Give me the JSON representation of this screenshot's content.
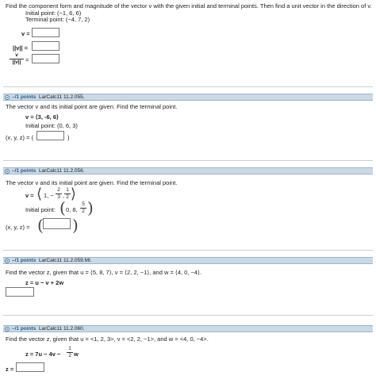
{
  "q1": {
    "instructions": "Find the component form and magnitude of the vector v with the given initial and terminal points. Then find a unit vector in the direction of v.",
    "initial_point": "Initial point: (−1, 6, 6)",
    "terminal_point": "Terminal point: (−4, 7, 2)",
    "v_label": "v =",
    "mag_label": "||v|| =",
    "unit_num": "v",
    "unit_den": "||v||",
    "equals": "="
  },
  "q2": {
    "points": "–/1 points",
    "source": "LarCalc11 11.2.055.",
    "instructions": "The vector v and its initial point are given. Find the terminal point.",
    "vector": "v = ⟨3, -6, 6⟩",
    "initial_point": "Initial point: (0, 6, 3)",
    "answer_label": "(x, y, z) = (",
    "close_paren": ")"
  },
  "q3": {
    "points": "–/1 points",
    "source": "LarCalc11 11.2.056.",
    "instructions": "The vector v and its initial point are given. Find the terminal point.",
    "v_label": "v =",
    "v_first": "1, −",
    "frac1_num": "2",
    "frac1_den": "3",
    "frac2_num": "1",
    "frac2_den": "2",
    "initial_label": "Initial point:",
    "ip_text": "0, 8,",
    "frac3_num": "5",
    "frac3_den": "2",
    "answer_label": "(x, y, z) ="
  },
  "q4": {
    "points": "–/1 points",
    "source": "LarCalc11 11.2.059.MI.",
    "instructions": "Find the vector z, given that u = ⟨5, 8, 7⟩, v = ⟨2, 2, −1⟩, and w = ⟨4, 0, −4⟩.",
    "equation": "z = u − v + 2w"
  },
  "q5": {
    "points": "–/1 points",
    "source": "LarCalc11 11.2.060.",
    "instructions": "Find the vector z, given that u = <1, 2, 3>, v = <2, 2, −1>, and w = <4, 0, −4>.",
    "eq_left": "z = 7u − 4v −",
    "frac_num": "1",
    "frac_den": "2",
    "eq_right": "w",
    "z_label": "z ="
  },
  "colors": {
    "header_bg": "#c9d9e6",
    "points_color": "#2a5d8a"
  }
}
